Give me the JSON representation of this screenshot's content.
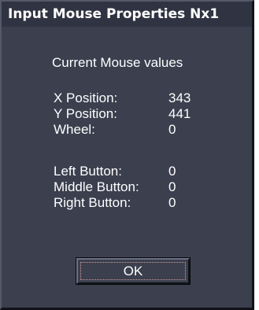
{
  "window": {
    "title": "Input Mouse Properties Nx1"
  },
  "heading": "Current Mouse values",
  "fields": [
    {
      "label": "X Position:",
      "value": "343"
    },
    {
      "label": "Y Position:",
      "value": "441"
    },
    {
      "label": "Wheel:",
      "value": "0"
    },
    {
      "label": "Left Button:",
      "value": "0"
    },
    {
      "label": "Middle Button:",
      "value": "0"
    },
    {
      "label": "Right Button:",
      "value": "0"
    }
  ],
  "ok_button": {
    "label": "OK"
  },
  "colors": {
    "window_bg": "#3b3f4e",
    "titlebar_bg": "#303442",
    "text": "#ffffff",
    "focus_ring": "#d8a0a0"
  }
}
